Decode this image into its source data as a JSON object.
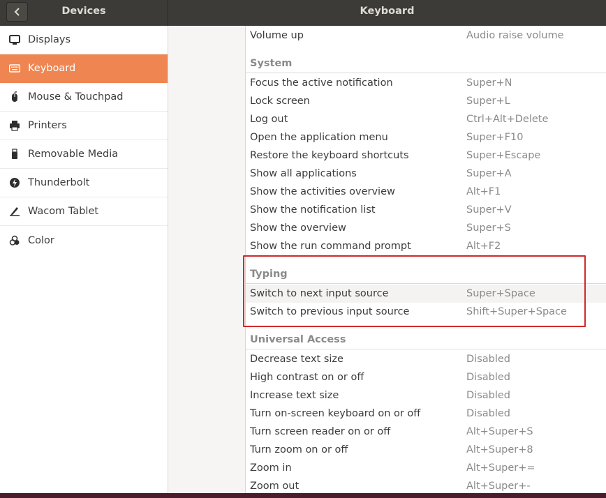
{
  "header": {
    "panel_title": "Devices",
    "main_title": "Keyboard"
  },
  "sidebar": {
    "items": [
      {
        "label": "Displays",
        "icon": "display-icon"
      },
      {
        "label": "Keyboard",
        "icon": "keyboard-icon",
        "active": true
      },
      {
        "label": "Mouse & Touchpad",
        "icon": "mouse-icon"
      },
      {
        "label": "Printers",
        "icon": "printer-icon"
      },
      {
        "label": "Removable Media",
        "icon": "usb-drive-icon"
      },
      {
        "label": "Thunderbolt",
        "icon": "thunderbolt-icon"
      },
      {
        "label": "Wacom Tablet",
        "icon": "tablet-icon"
      },
      {
        "label": "Color",
        "icon": "color-icon"
      }
    ]
  },
  "shortcuts": {
    "top": {
      "name": "Volume up",
      "accel": "Audio raise volume"
    },
    "system": {
      "title": "System",
      "rows": [
        {
          "name": "Focus the active notification",
          "accel": "Super+N"
        },
        {
          "name": "Lock screen",
          "accel": "Super+L"
        },
        {
          "name": "Log out",
          "accel": "Ctrl+Alt+Delete"
        },
        {
          "name": "Open the application menu",
          "accel": "Super+F10"
        },
        {
          "name": "Restore the keyboard shortcuts",
          "accel": "Super+Escape"
        },
        {
          "name": "Show all applications",
          "accel": "Super+A"
        },
        {
          "name": "Show the activities overview",
          "accel": "Alt+F1"
        },
        {
          "name": "Show the notification list",
          "accel": "Super+V"
        },
        {
          "name": "Show the overview",
          "accel": "Super+S"
        },
        {
          "name": "Show the run command prompt",
          "accel": "Alt+F2"
        }
      ]
    },
    "typing": {
      "title": "Typing",
      "rows": [
        {
          "name": "Switch to next input source",
          "accel": "Super+Space"
        },
        {
          "name": "Switch to previous input source",
          "accel": "Shift+Super+Space"
        }
      ]
    },
    "universal": {
      "title": "Universal Access",
      "rows": [
        {
          "name": "Decrease text size",
          "accel": "Disabled"
        },
        {
          "name": "High contrast on or off",
          "accel": "Disabled"
        },
        {
          "name": "Increase text size",
          "accel": "Disabled"
        },
        {
          "name": "Turn on-screen keyboard on or off",
          "accel": "Disabled"
        },
        {
          "name": "Turn screen reader on or off",
          "accel": "Alt+Super+S"
        },
        {
          "name": "Turn zoom on or off",
          "accel": "Alt+Super+8"
        },
        {
          "name": "Zoom in",
          "accel": "Alt+Super+="
        },
        {
          "name": "Zoom out",
          "accel": "Alt+Super+-"
        }
      ]
    }
  },
  "colors": {
    "accent": "#ef8551",
    "titlebar": "#3c3b37",
    "highlight_box": "#d12a2a"
  }
}
